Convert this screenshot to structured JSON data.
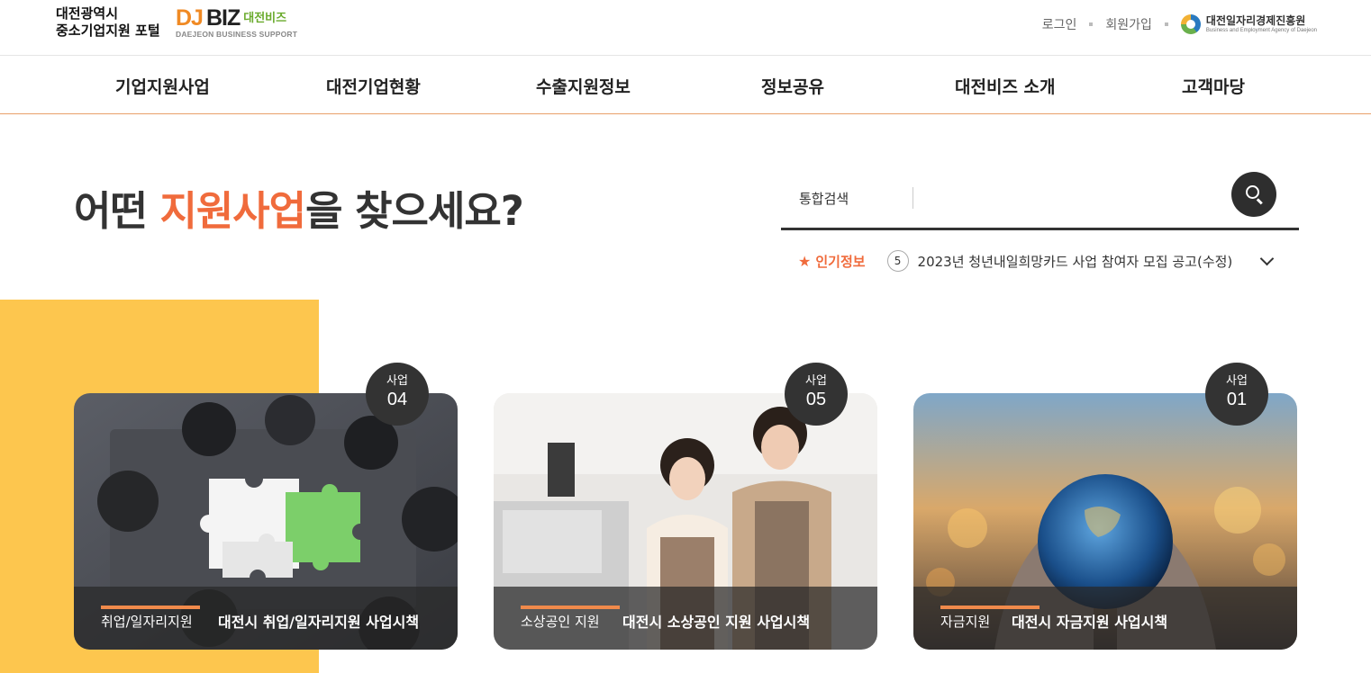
{
  "header": {
    "org_line1": "대전광역시",
    "org_line2": "중소기업지원 포털",
    "logo_dj": "DJ",
    "logo_biz": "BIZ",
    "logo_kr": "대전비즈",
    "logo_sub": "DAEJEON BUSINESS SUPPORT",
    "login": "로그인",
    "signup": "회원가입",
    "agency_kr": "대전일자리경제진흥원",
    "agency_en": "Business and Employment Agency of Daejeon"
  },
  "nav": {
    "items": [
      "기업지원사업",
      "대전기업현황",
      "수출지원정보",
      "정보공유",
      "대전비즈 소개",
      "고객마당"
    ]
  },
  "hero": {
    "title_pre": "어떤 ",
    "title_accent": "지원사업",
    "title_post": "을 찾으세요?"
  },
  "search": {
    "label": "통합검색",
    "value": "",
    "placeholder": ""
  },
  "popular": {
    "label": "인기정보",
    "rank": "5",
    "text": "2023년 청년내일희망카드 사업 참여자 모집 공고(수정)"
  },
  "cards": [
    {
      "badge_label": "사업",
      "badge_num": "04",
      "category": "취업/일자리지원",
      "title": "대전시 취업/일자리지원 사업시책"
    },
    {
      "badge_label": "사업",
      "badge_num": "05",
      "category": "소상공인 지원",
      "title": "대전시 소상공인 지원 사업시책"
    },
    {
      "badge_label": "사업",
      "badge_num": "01",
      "category": "자금지원",
      "title": "대전시 자금지원 사업시책"
    }
  ],
  "colors": {
    "accent": "#f06b3c",
    "logo_orange": "#f08a24",
    "yellow": "#fdc64e",
    "dark": "#333333"
  }
}
